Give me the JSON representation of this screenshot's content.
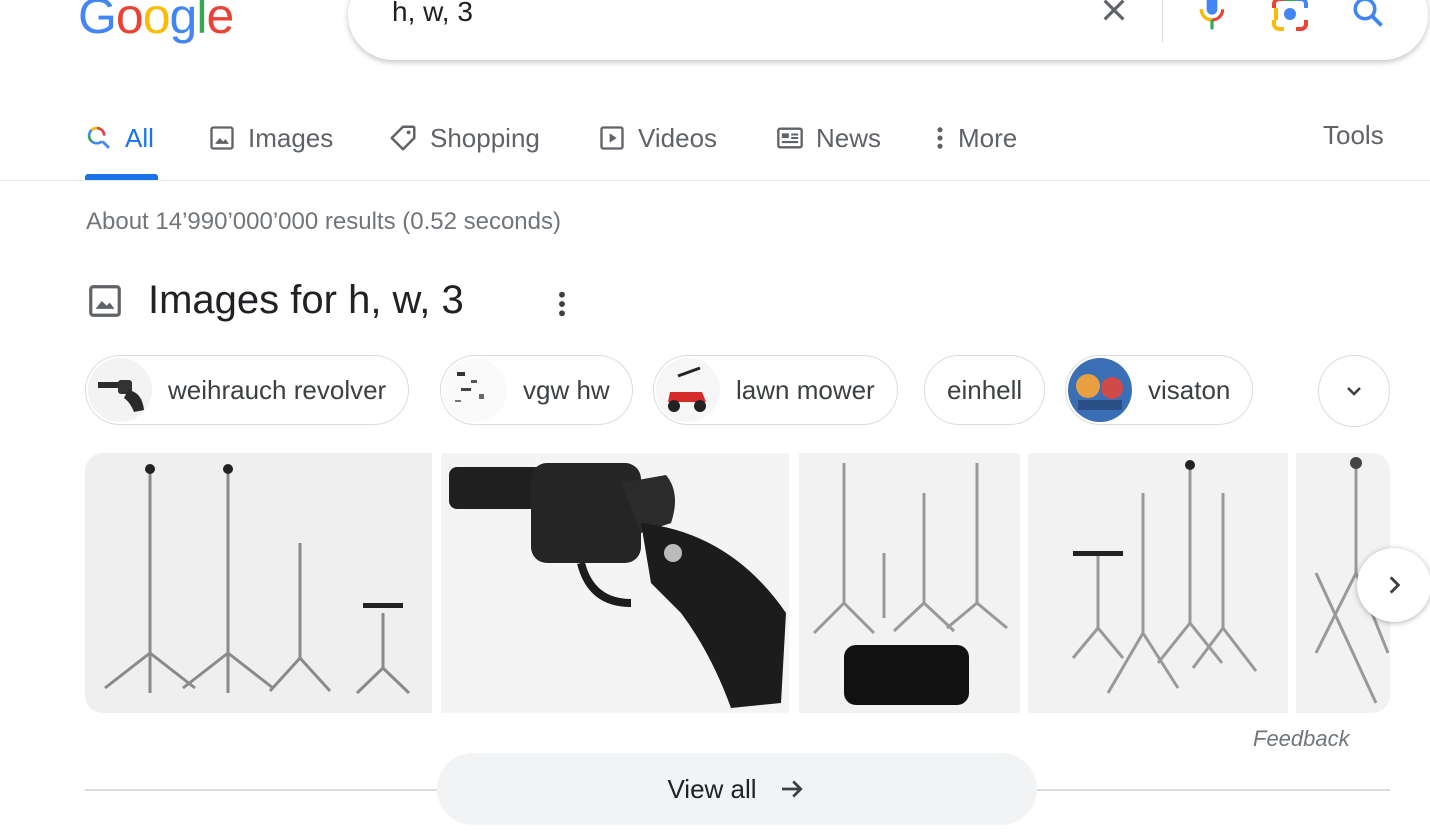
{
  "logo": {
    "letters": [
      "G",
      "o",
      "o",
      "g",
      "l",
      "e"
    ],
    "colors": [
      "#4285f4",
      "#ea4335",
      "#fbbc05",
      "#4285f4",
      "#34a853",
      "#ea4335"
    ]
  },
  "search": {
    "query": "h, w, 3",
    "icons": [
      "clear-icon",
      "microphone-icon",
      "lens-icon",
      "search-icon"
    ]
  },
  "tabs": [
    {
      "label": "All",
      "icon": "search-icon",
      "active": true
    },
    {
      "label": "Images",
      "icon": "image-icon"
    },
    {
      "label": "Shopping",
      "icon": "tag-icon"
    },
    {
      "label": "Videos",
      "icon": "play-icon"
    },
    {
      "label": "News",
      "icon": "news-icon"
    },
    {
      "label": "More",
      "icon": "more-vert-icon"
    }
  ],
  "tools_label": "Tools",
  "stats": "About 14’990’000’000 results (0.52 seconds)",
  "images_section": {
    "title": "Images for h, w, 3",
    "chips": [
      {
        "label": "weihrauch revolver"
      },
      {
        "label": "vgw hw"
      },
      {
        "label": "lawn mower"
      },
      {
        "label": "einhell"
      },
      {
        "label": "visaton"
      }
    ],
    "feedback": "Feedback",
    "view_all": "View all"
  },
  "colors": {
    "accent": "#1a73e8",
    "muted": "#70757a",
    "border": "#dadce0"
  }
}
